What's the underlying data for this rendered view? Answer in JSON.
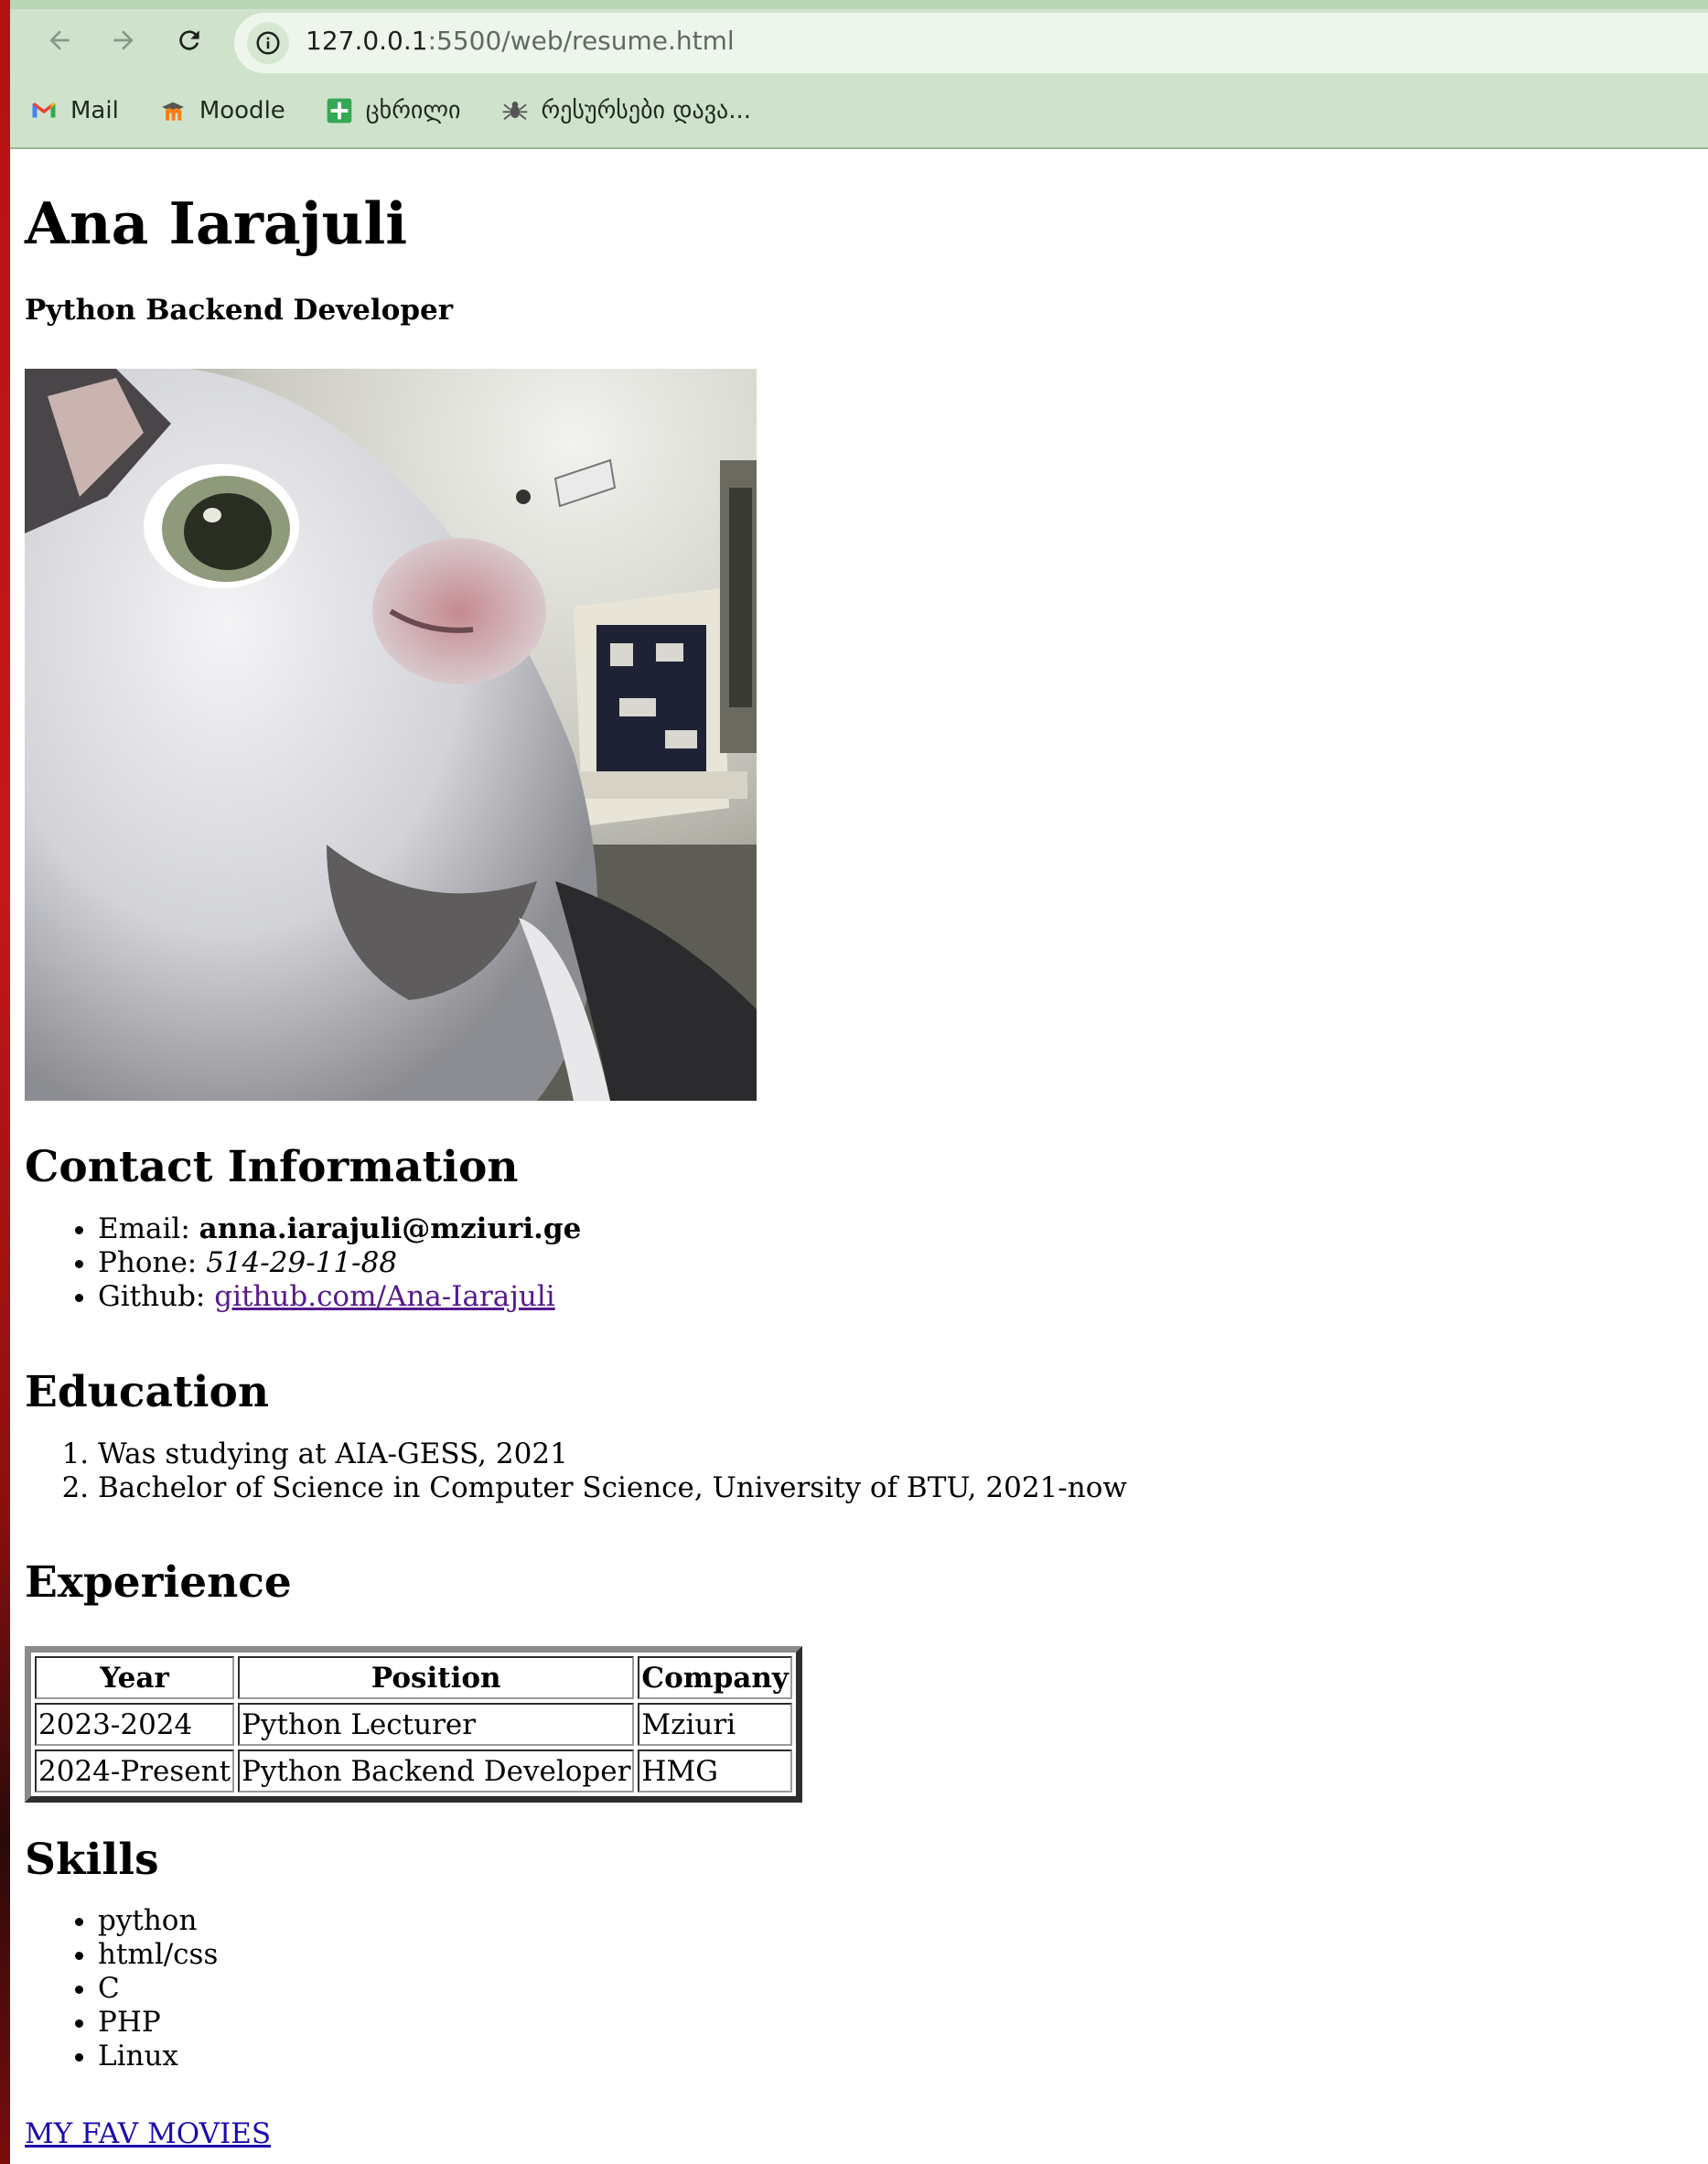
{
  "browser": {
    "url_host": "127.0.0.1",
    "url_path": ":5500/web/resume.html",
    "bookmarks": [
      {
        "label": "Mail",
        "icon": "gmail-icon"
      },
      {
        "label": "Moodle",
        "icon": "moodle-icon"
      },
      {
        "label": "ცხრილი",
        "icon": "sheets-icon"
      },
      {
        "label": "რესურსები დავა...",
        "icon": "spider-icon"
      }
    ]
  },
  "resume": {
    "name": "Ana Iarajuli",
    "title": "Python Backend Developer",
    "photo_alt": "cat-photo",
    "contact": {
      "heading": "Contact Information",
      "email_label": "Email: ",
      "email_value": "anna.iarajuli@mziuri.ge",
      "phone_label": "Phone: ",
      "phone_value": "514-29-11-88",
      "github_label": "Github: ",
      "github_value": "github.com/Ana-Iarajuli"
    },
    "education": {
      "heading": "Education",
      "items": [
        "Was studying at AIA-GESS, 2021",
        "Bachelor of Science in Computer Science, University of BTU, 2021-now"
      ]
    },
    "experience": {
      "heading": "Experience",
      "columns": [
        "Year",
        "Position",
        "Company"
      ],
      "rows": [
        [
          "2023-2024",
          "Python Lecturer",
          "Mziuri"
        ],
        [
          "2024-Present",
          "Python Backend Developer",
          "HMG"
        ]
      ]
    },
    "skills": {
      "heading": "Skills",
      "items": [
        "python",
        "html/css",
        "C",
        "PHP",
        "Linux"
      ]
    },
    "fav_link": "MY FAV MOVIES"
  }
}
